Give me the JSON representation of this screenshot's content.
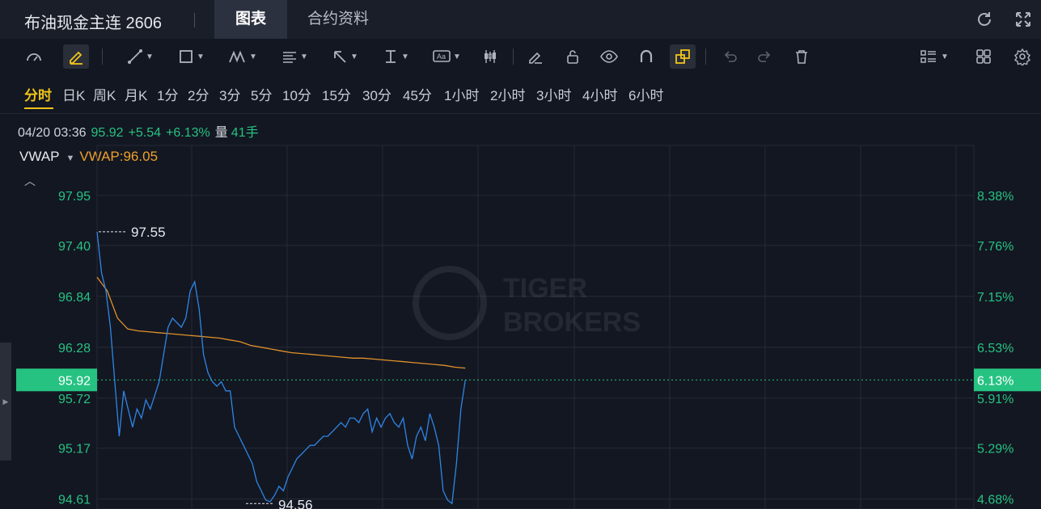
{
  "header": {
    "title": "布油现金主连 2606",
    "tabs": [
      {
        "label": "图表",
        "active": true
      },
      {
        "label": "合约资料",
        "active": false
      }
    ]
  },
  "toolbar": {
    "icons": [
      "gauge-icon",
      "pencil-icon",
      "line-icon",
      "rectangle-icon",
      "pattern-icon",
      "fib-icon",
      "arrow-icon",
      "vertical-measure-icon",
      "text-icon",
      "candle-icon",
      "eraser-icon",
      "unlock-icon",
      "eye-icon",
      "magnet-icon",
      "link-icon",
      "undo-icon",
      "redo-icon",
      "trash-icon",
      "list-icon",
      "grid-icon",
      "settings-icon"
    ]
  },
  "periods": [
    "分时",
    "日K",
    "周K",
    "月K",
    "1分",
    "2分",
    "3分",
    "5分",
    "10分",
    "15分",
    "30分",
    "45分",
    "1小时",
    "2小时",
    "3小时",
    "4小时",
    "6小时"
  ],
  "active_period": "分时",
  "info": {
    "datetime": "04/20 03:36",
    "price": "95.92",
    "change": "+5.54",
    "change_pct": "+6.13%",
    "volume_label": "量",
    "volume": "41手"
  },
  "indicator": {
    "name": "VWAP",
    "value_text": "VWAP:96.05"
  },
  "colors": {
    "price_line": "#2f86e6",
    "vwap_line": "#e0912a",
    "up": "#26c281",
    "grid": "#262a35",
    "background": "#131722"
  },
  "chart_data": {
    "type": "line",
    "y_ticks": [
      "97.95",
      "97.40",
      "96.84",
      "96.28",
      "95.72",
      "95.17",
      "94.61"
    ],
    "y_ticks_pct": [
      "8.38%",
      "7.76%",
      "7.15%",
      "6.53%",
      "5.91%",
      "5.29%",
      "4.68%"
    ],
    "current_price": "95.92",
    "current_pct": "6.13%",
    "high_label": "97.55",
    "low_label": "94.56",
    "ylim": [
      94.5,
      98.5
    ],
    "x_fraction_visible": 0.42,
    "series": [
      {
        "kind": "price",
        "values": [
          97.55,
          97.1,
          96.9,
          96.5,
          95.9,
          95.3,
          95.8,
          95.6,
          95.4,
          95.6,
          95.5,
          95.7,
          95.6,
          95.75,
          95.9,
          96.2,
          96.5,
          96.6,
          96.55,
          96.5,
          96.6,
          96.9,
          97.0,
          96.7,
          96.2,
          96.0,
          95.9,
          95.85,
          95.9,
          95.8,
          95.8,
          95.4,
          95.3,
          95.2,
          95.1,
          95.0,
          94.8,
          94.7,
          94.6,
          94.58,
          94.65,
          94.75,
          94.7,
          94.85,
          94.95,
          95.05,
          95.1,
          95.15,
          95.2,
          95.2,
          95.25,
          95.3,
          95.3,
          95.35,
          95.4,
          95.45,
          95.4,
          95.5,
          95.5,
          95.45,
          95.55,
          95.6,
          95.35,
          95.5,
          95.4,
          95.5,
          95.55,
          95.45,
          95.4,
          95.5,
          95.2,
          95.05,
          95.3,
          95.4,
          95.25,
          95.55,
          95.4,
          95.2,
          94.7,
          94.6,
          94.56,
          95.0,
          95.6,
          95.92
        ]
      },
      {
        "kind": "vwap",
        "values": [
          97.05,
          96.9,
          96.6,
          96.48,
          96.46,
          96.45,
          96.44,
          96.43,
          96.42,
          96.41,
          96.4,
          96.39,
          96.38,
          96.36,
          96.34,
          96.3,
          96.28,
          96.26,
          96.24,
          96.22,
          96.21,
          96.2,
          96.19,
          96.18,
          96.17,
          96.16,
          96.16,
          96.15,
          96.14,
          96.13,
          96.12,
          96.11,
          96.1,
          96.09,
          96.08,
          96.06,
          96.05
        ]
      }
    ]
  }
}
